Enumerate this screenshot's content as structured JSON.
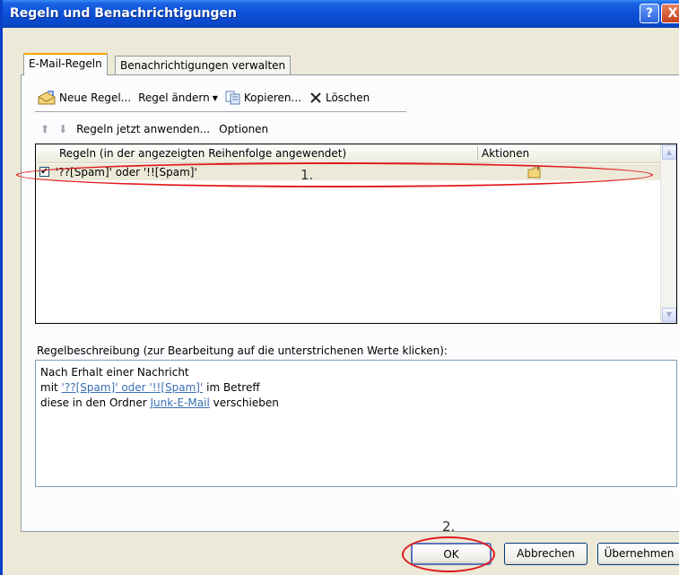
{
  "window": {
    "title": "Regeln und Benachrichtigungen",
    "help_glyph": "?",
    "close_glyph": "X"
  },
  "tabs": [
    {
      "label": "E-Mail-Regeln",
      "active": true
    },
    {
      "label": "Benachrichtigungen verwalten",
      "active": false
    }
  ],
  "toolbar": {
    "new_rule": "Neue Regel...",
    "change_rule": "Regel ändern",
    "copy": "Kopieren...",
    "delete": "Löschen"
  },
  "toolbar2": {
    "up_glyph": "⬆",
    "down_glyph": "⬇",
    "apply_now": "Regeln jetzt anwenden...",
    "options": "Optionen"
  },
  "rules_list": {
    "col_rules": "Regeln (in der angezeigten Reihenfolge angewendet)",
    "col_actions": "Aktionen",
    "rows": [
      {
        "checked": true,
        "check_glyph": "✔",
        "name": "'??[Spam]' oder '!![Spam]'"
      }
    ]
  },
  "description": {
    "label": "Regelbeschreibung (zur Bearbeitung auf die unterstrichenen Werte klicken):",
    "line1": "Nach Erhalt einer Nachricht",
    "line2_prefix": "mit ",
    "line2_link": "'??[Spam]' oder '!![Spam]'",
    "line2_suffix": " im Betreff",
    "line3_prefix": "diese in den Ordner ",
    "line3_link": "Junk-E-Mail",
    "line3_suffix": " verschieben"
  },
  "buttons": {
    "ok": "OK",
    "cancel": "Abbrechen",
    "apply": "Übernehmen"
  },
  "annotations": {
    "one": "1.",
    "two": "2.",
    "color": "#e0191c"
  }
}
